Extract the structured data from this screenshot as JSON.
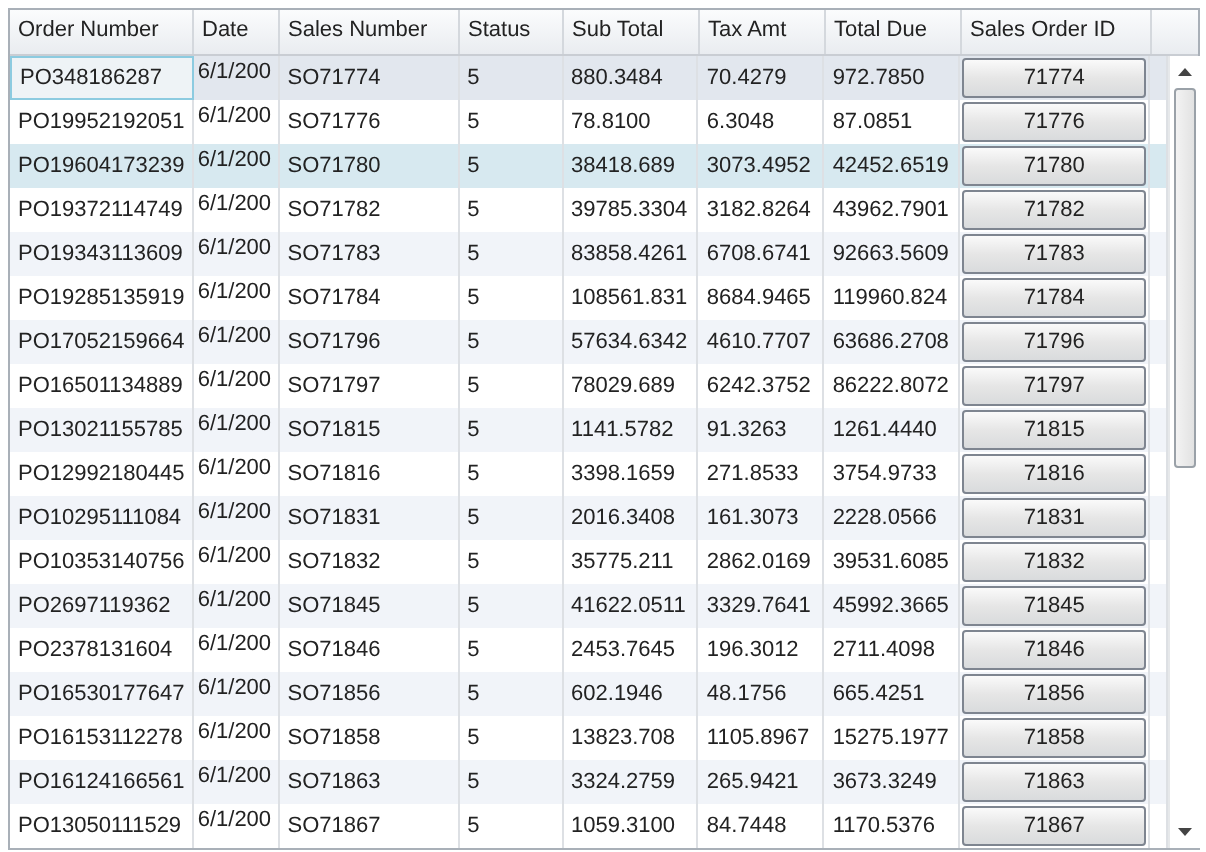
{
  "table": {
    "columns": [
      {
        "label": "Order Number",
        "kind": "text"
      },
      {
        "label": "Date",
        "kind": "date"
      },
      {
        "label": "Sales Number",
        "kind": "text"
      },
      {
        "label": "Status",
        "kind": "text"
      },
      {
        "label": "Sub Total",
        "kind": "text"
      },
      {
        "label": "Tax Amt",
        "kind": "text"
      },
      {
        "label": "Total Due",
        "kind": "text"
      },
      {
        "label": "Sales Order ID",
        "kind": "button"
      }
    ],
    "rows": [
      {
        "selected": true,
        "highlighted": false,
        "cells": [
          "PO348186287",
          "6/1/200",
          "SO71774",
          "5",
          "880.3484",
          "70.4279",
          "972.7850",
          "71774"
        ]
      },
      {
        "selected": false,
        "highlighted": false,
        "cells": [
          "PO19952192051",
          "6/1/200",
          "SO71776",
          "5",
          "78.8100",
          "6.3048",
          "87.0851",
          "71776"
        ]
      },
      {
        "selected": false,
        "highlighted": true,
        "cells": [
          "PO19604173239",
          "6/1/200",
          "SO71780",
          "5",
          "38418.689",
          "3073.4952",
          "42452.6519",
          "71780"
        ]
      },
      {
        "selected": false,
        "highlighted": false,
        "cells": [
          "PO19372114749",
          "6/1/200",
          "SO71782",
          "5",
          "39785.3304",
          "3182.8264",
          "43962.7901",
          "71782"
        ]
      },
      {
        "selected": false,
        "highlighted": false,
        "cells": [
          "PO19343113609",
          "6/1/200",
          "SO71783",
          "5",
          "83858.4261",
          "6708.6741",
          "92663.5609",
          "71783"
        ]
      },
      {
        "selected": false,
        "highlighted": false,
        "cells": [
          "PO19285135919",
          "6/1/200",
          "SO71784",
          "5",
          "108561.831",
          "8684.9465",
          "119960.824",
          "71784"
        ]
      },
      {
        "selected": false,
        "highlighted": false,
        "cells": [
          "PO17052159664",
          "6/1/200",
          "SO71796",
          "5",
          "57634.6342",
          "4610.7707",
          "63686.2708",
          "71796"
        ]
      },
      {
        "selected": false,
        "highlighted": false,
        "cells": [
          "PO16501134889",
          "6/1/200",
          "SO71797",
          "5",
          "78029.689",
          "6242.3752",
          "86222.8072",
          "71797"
        ]
      },
      {
        "selected": false,
        "highlighted": false,
        "cells": [
          "PO13021155785",
          "6/1/200",
          "SO71815",
          "5",
          "1141.5782",
          "91.3263",
          "1261.4440",
          "71815"
        ]
      },
      {
        "selected": false,
        "highlighted": false,
        "cells": [
          "PO12992180445",
          "6/1/200",
          "SO71816",
          "5",
          "3398.1659",
          "271.8533",
          "3754.9733",
          "71816"
        ]
      },
      {
        "selected": false,
        "highlighted": false,
        "cells": [
          "PO10295111084",
          "6/1/200",
          "SO71831",
          "5",
          "2016.3408",
          "161.3073",
          "2228.0566",
          "71831"
        ]
      },
      {
        "selected": false,
        "highlighted": false,
        "cells": [
          "PO10353140756",
          "6/1/200",
          "SO71832",
          "5",
          "35775.211",
          "2862.0169",
          "39531.6085",
          "71832"
        ]
      },
      {
        "selected": false,
        "highlighted": false,
        "cells": [
          "PO2697119362",
          "6/1/200",
          "SO71845",
          "5",
          "41622.0511",
          "3329.7641",
          "45992.3665",
          "71845"
        ]
      },
      {
        "selected": false,
        "highlighted": false,
        "cells": [
          "PO2378131604",
          "6/1/200",
          "SO71846",
          "5",
          "2453.7645",
          "196.3012",
          "2711.4098",
          "71846"
        ]
      },
      {
        "selected": false,
        "highlighted": false,
        "cells": [
          "PO16530177647",
          "6/1/200",
          "SO71856",
          "5",
          "602.1946",
          "48.1756",
          "665.4251",
          "71856"
        ]
      },
      {
        "selected": false,
        "highlighted": false,
        "cells": [
          "PO16153112278",
          "6/1/200",
          "SO71858",
          "5",
          "13823.708",
          "1105.8967",
          "15275.1977",
          "71858"
        ]
      },
      {
        "selected": false,
        "highlighted": false,
        "cells": [
          "PO16124166561",
          "6/1/200",
          "SO71863",
          "5",
          "3324.2759",
          "265.9421",
          "3673.3249",
          "71863"
        ]
      },
      {
        "selected": false,
        "highlighted": false,
        "cells": [
          "PO13050111529",
          "6/1/200",
          "SO71867",
          "5",
          "1059.3100",
          "84.7448",
          "1170.5376",
          "71867"
        ]
      }
    ]
  }
}
